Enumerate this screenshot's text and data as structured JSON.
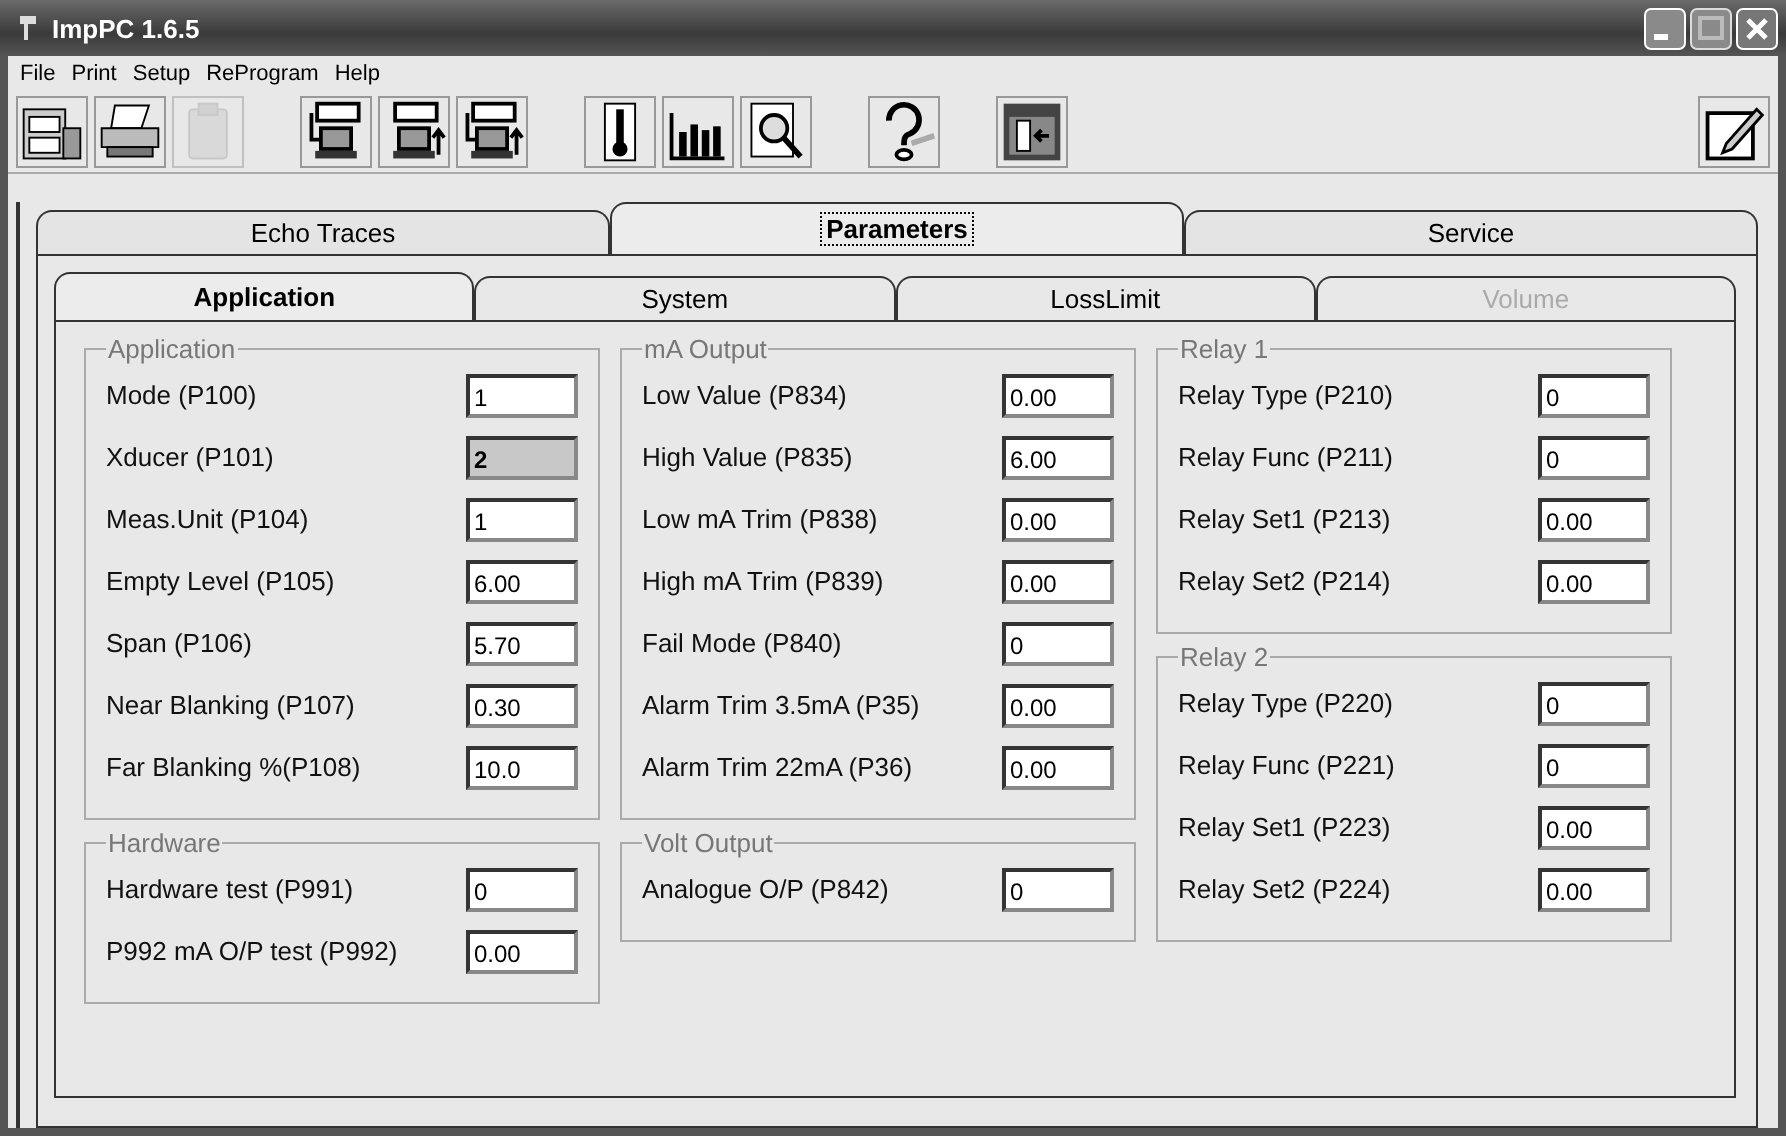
{
  "window": {
    "title": "ImpPC 1.6.5"
  },
  "menu": [
    "File",
    "Print",
    "Setup",
    "ReProgram",
    "Help"
  ],
  "toolbar": {
    "groups": [
      [
        {
          "kind": "cabinet",
          "disabled": false
        },
        {
          "kind": "printer",
          "disabled": false
        },
        {
          "kind": "clipboard",
          "disabled": true
        }
      ],
      [
        {
          "kind": "device",
          "disabled": false
        },
        {
          "kind": "device-up",
          "disabled": false
        },
        {
          "kind": "device-swap",
          "disabled": false
        }
      ],
      [
        {
          "kind": "thermometer",
          "disabled": false
        },
        {
          "kind": "bars",
          "disabled": false
        },
        {
          "kind": "magnifier",
          "disabled": false
        }
      ],
      [
        {
          "kind": "help",
          "disabled": false
        }
      ],
      [
        {
          "kind": "exit",
          "disabled": false
        }
      ]
    ],
    "right": [
      {
        "kind": "edit",
        "disabled": false
      }
    ]
  },
  "tabs": [
    {
      "label": "Echo Traces",
      "selected": false
    },
    {
      "label": "Parameters",
      "selected": true
    },
    {
      "label": "Service",
      "selected": false
    }
  ],
  "subtabs": [
    {
      "label": "Application",
      "selected": true,
      "disabled": false
    },
    {
      "label": "System",
      "selected": false,
      "disabled": false
    },
    {
      "label": "LossLimit",
      "selected": false,
      "disabled": false
    },
    {
      "label": "Volume",
      "selected": false,
      "disabled": true
    }
  ],
  "columns": [
    [
      {
        "title": "Application",
        "fields": [
          {
            "label": "Mode (P100)",
            "value": "1",
            "disabled": false
          },
          {
            "label": "Xducer (P101)",
            "value": "2",
            "disabled": true
          },
          {
            "label": "Meas.Unit (P104)",
            "value": "1",
            "disabled": false
          },
          {
            "label": "Empty Level (P105)",
            "value": "6.00",
            "disabled": false
          },
          {
            "label": "Span (P106)",
            "value": "5.70",
            "disabled": false
          },
          {
            "label": "Near Blanking (P107)",
            "value": "0.30",
            "disabled": false
          },
          {
            "label": "Far Blanking %(P108)",
            "value": "10.0",
            "disabled": false
          }
        ]
      },
      {
        "title": "Hardware",
        "fields": [
          {
            "label": "Hardware test (P991)",
            "value": "0",
            "disabled": false
          },
          {
            "label": "P992 mA O/P test (P992)",
            "value": "0.00",
            "disabled": false
          }
        ]
      }
    ],
    [
      {
        "title": "mA Output",
        "fields": [
          {
            "label": "Low Value (P834)",
            "value": "0.00",
            "disabled": false
          },
          {
            "label": "High Value (P835)",
            "value": "6.00",
            "disabled": false
          },
          {
            "label": "Low mA Trim (P838)",
            "value": "0.00",
            "disabled": false
          },
          {
            "label": "High mA Trim (P839)",
            "value": "0.00",
            "disabled": false
          },
          {
            "label": "Fail Mode (P840)",
            "value": "0",
            "disabled": false
          },
          {
            "label": "Alarm Trim 3.5mA (P35)",
            "value": "0.00",
            "disabled": false
          },
          {
            "label": "Alarm Trim 22mA (P36)",
            "value": "0.00",
            "disabled": false
          }
        ]
      },
      {
        "title": "Volt Output",
        "fields": [
          {
            "label": "Analogue O/P (P842)",
            "value": "0",
            "disabled": false
          }
        ]
      }
    ],
    [
      {
        "title": "Relay 1",
        "fields": [
          {
            "label": "Relay Type (P210)",
            "value": "0",
            "disabled": false
          },
          {
            "label": "Relay Func (P211)",
            "value": "0",
            "disabled": false
          },
          {
            "label": "Relay Set1 (P213)",
            "value": "0.00",
            "disabled": false
          },
          {
            "label": "Relay Set2 (P214)",
            "value": "0.00",
            "disabled": false
          }
        ]
      },
      {
        "title": "Relay 2",
        "fields": [
          {
            "label": "Relay Type (P220)",
            "value": "0",
            "disabled": false
          },
          {
            "label": "Relay Func (P221)",
            "value": "0",
            "disabled": false
          },
          {
            "label": "Relay Set1 (P223)",
            "value": "0.00",
            "disabled": false
          },
          {
            "label": "Relay Set2 (P224)",
            "value": "0.00",
            "disabled": false
          }
        ]
      }
    ]
  ]
}
